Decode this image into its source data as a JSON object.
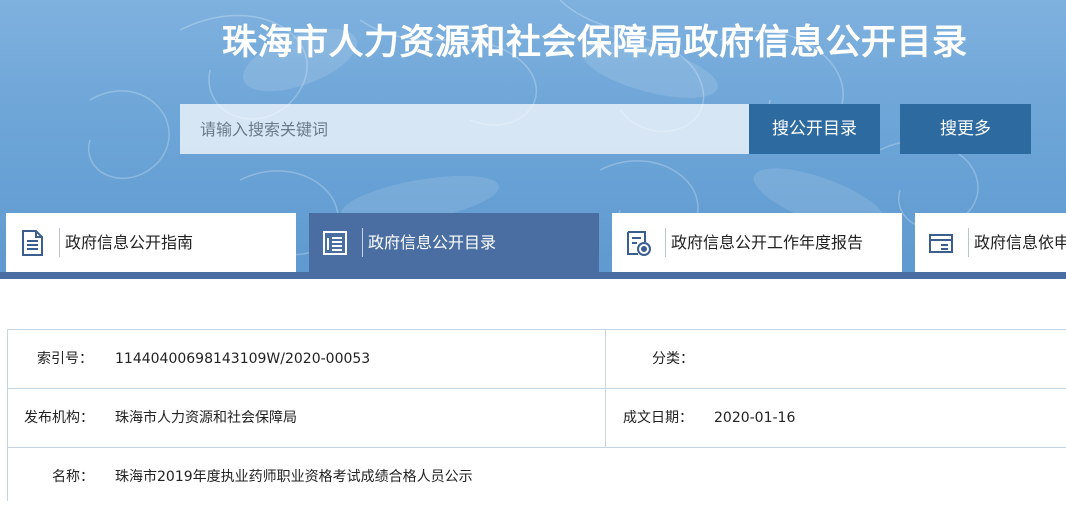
{
  "header": {
    "title": "珠海市人力资源和社会保障局政府信息公开目录"
  },
  "search": {
    "placeholder": "请输入搜索关键词",
    "catalog_button": "搜公开目录",
    "more_button": "搜更多"
  },
  "tabs": [
    {
      "label": "政府信息公开指南",
      "icon": "document-lines-icon",
      "active": false
    },
    {
      "label": "政府信息公开目录",
      "icon": "catalog-list-icon",
      "active": true
    },
    {
      "label": "政府信息公开工作年度报告",
      "icon": "report-seal-icon",
      "active": false
    },
    {
      "label": "政府信息依申",
      "icon": "application-form-icon",
      "active": false
    }
  ],
  "info": {
    "index_label": "索引号：",
    "index_value": "11440400698143109W/2020-00053",
    "category_label": "分类：",
    "category_value": "",
    "publisher_label": "发布机构：",
    "publisher_value": "珠海市人力资源和社会保障局",
    "date_label": "成文日期：",
    "date_value": "2020-01-16",
    "name_label": "名称：",
    "name_value": "珠海市2019年度执业药师职业资格考试成绩合格人员公示"
  },
  "colors": {
    "banner": "#6ea6d8",
    "button": "#2c6aa0",
    "active_tab": "#4a6ea2",
    "table_border": "#c4d5e6"
  }
}
